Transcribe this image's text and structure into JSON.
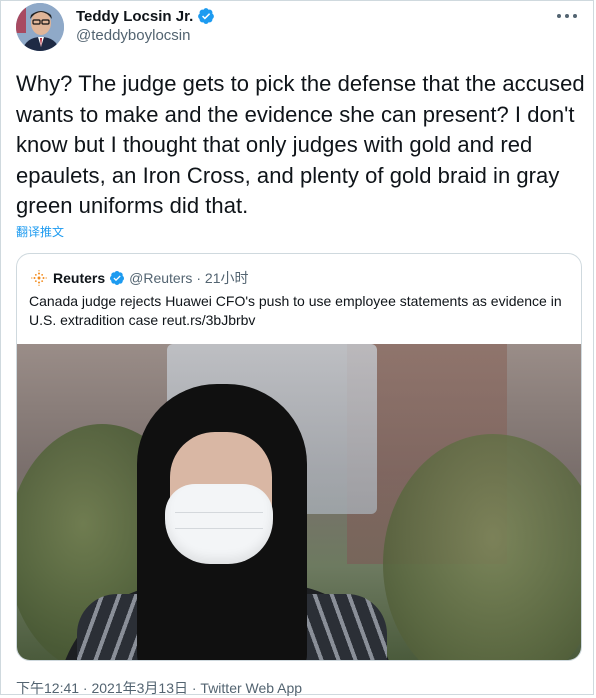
{
  "author": {
    "name": "Teddy Locsin Jr.",
    "handle": "@teddyboylocsin",
    "verified_icon": "verified-badge-icon"
  },
  "tweet": {
    "text": "Why? The judge gets to pick the defense that the accused wants to make and the evidence she can present? I don't know but I thought that only judges with gold and red epaulets, an Iron Cross, and plenty of gold braid in gray green uniforms did that.",
    "translate_label": "翻译推文"
  },
  "quote": {
    "name": "Reuters",
    "handle": "@Reuters",
    "time": "· 21小时",
    "text": "Canada judge rejects Huawei CFO's push to use employee statements as evidence in U.S. extradition case reut.rs/3bJbrbv"
  },
  "footer": {
    "timestamp": "下午12:41 · 2021年3月13日 · Twitter Web App"
  },
  "colors": {
    "link": "#1d9bf0",
    "secondary_text": "#536471",
    "primary_text": "#0f1419",
    "border": "#cfd9de"
  }
}
